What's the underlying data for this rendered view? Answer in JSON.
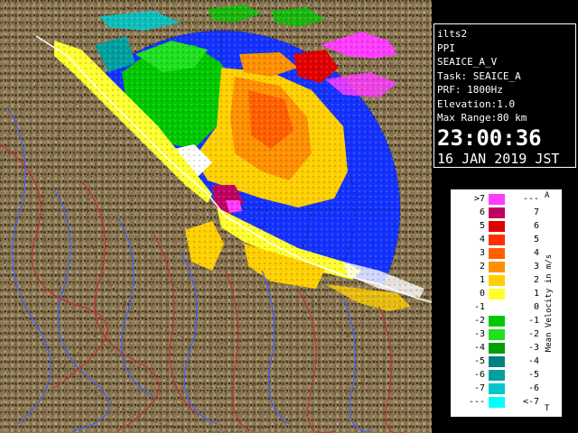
{
  "radar": {
    "station": "ilts2",
    "product": "PPI",
    "volume": "SEAICE_A_V",
    "task": "Task: SEAICE_A",
    "prf": "PRF: 1800Hz",
    "elevation": "Elevation:1.0",
    "max_range": "Max Range:80 km",
    "time": "23:00:36",
    "date": "16 JAN 2019 JST"
  },
  "legend": {
    "unit": "Mean Velocity in m/s",
    "top_mark": "A",
    "bottom_mark": "T",
    "rows": [
      {
        "left": ">7",
        "right": "---",
        "color": "#ff3cff"
      },
      {
        "left": "6",
        "right": "7",
        "color": "#c00060"
      },
      {
        "left": "5",
        "right": "6",
        "color": "#e00000"
      },
      {
        "left": "4",
        "right": "5",
        "color": "#ff3000"
      },
      {
        "left": "3",
        "right": "4",
        "color": "#ff6000"
      },
      {
        "left": "2",
        "right": "3",
        "color": "#ff9000"
      },
      {
        "left": "1",
        "right": "2",
        "color": "#ffd000"
      },
      {
        "left": "0",
        "right": "1",
        "color": "#ffff30"
      },
      {
        "left": "-1",
        "right": "0",
        "color": "#ffffff"
      },
      {
        "left": "-2",
        "right": "-1",
        "color": "#00c800"
      },
      {
        "left": "-3",
        "right": "-2",
        "color": "#20e020"
      },
      {
        "left": "-4",
        "right": "-3",
        "color": "#00a000"
      },
      {
        "left": "-5",
        "right": "-4",
        "color": "#008080"
      },
      {
        "left": "-6",
        "right": "-5",
        "color": "#00a0a0"
      },
      {
        "left": "-7",
        "right": "-6",
        "color": "#00c8c8"
      },
      {
        "left": "---",
        "right": "<-7",
        "color": "#00ffff"
      }
    ]
  },
  "colors": {
    "background": "#000000",
    "ocean": "#1432ff",
    "land": "#7a6a4a"
  }
}
